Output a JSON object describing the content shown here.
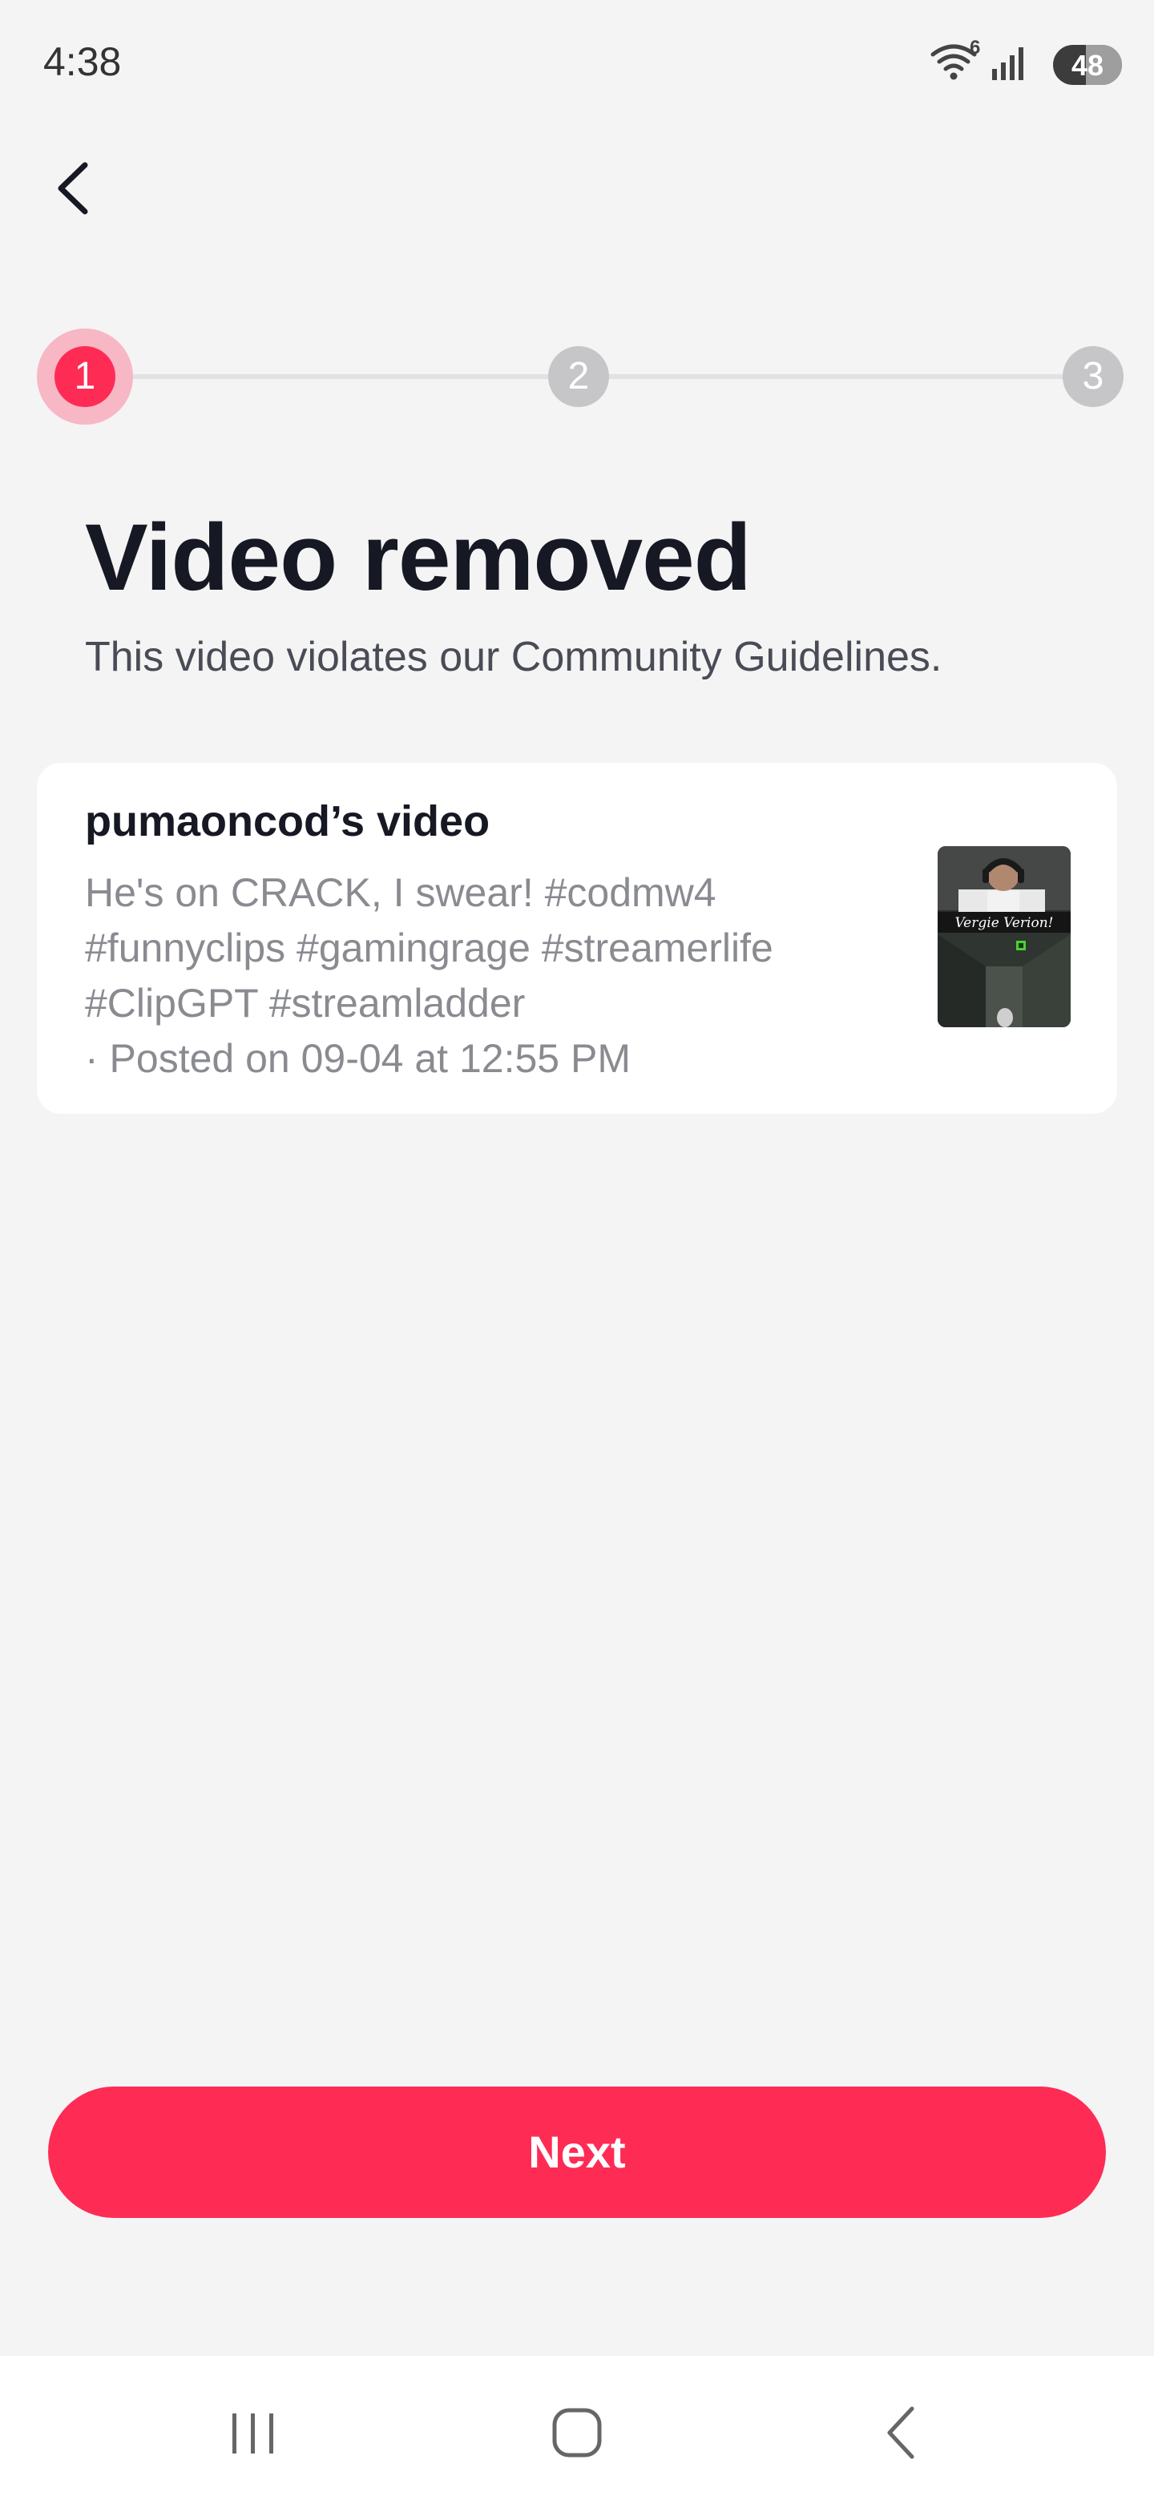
{
  "status_bar": {
    "time": "4:38",
    "wifi_badge": "6",
    "battery_level": "48",
    "battery_fraction": 0.48
  },
  "nav": {
    "back_icon": "chevron-left-icon"
  },
  "stepper": {
    "steps": [
      "1",
      "2",
      "3"
    ],
    "active_index": 0
  },
  "heading": {
    "title": "Video removed",
    "subtitle": "This video violates our Community Guidelines."
  },
  "video_card": {
    "title": "pumaoncod’s video",
    "description_lines": [
      "He's on CRACK, I swear! #codmw4",
      "#funnyclips #gamingrage #streamerlife",
      "#ClipGPT #streamladder",
      "· Posted on 09-04 at 12:55 PM"
    ],
    "thumbnail_caption": "Vergie Verion!"
  },
  "actions": {
    "next_label": "Next"
  },
  "system_nav": {
    "recents_icon": "recents-icon",
    "home_icon": "home-icon",
    "back_icon": "back-icon"
  },
  "colors": {
    "accent": "#fe2c55",
    "accent_halo": "#f8b7c4",
    "background": "#f4f4f5",
    "card": "#ffffff",
    "step_inactive": "#c6c6c8"
  }
}
